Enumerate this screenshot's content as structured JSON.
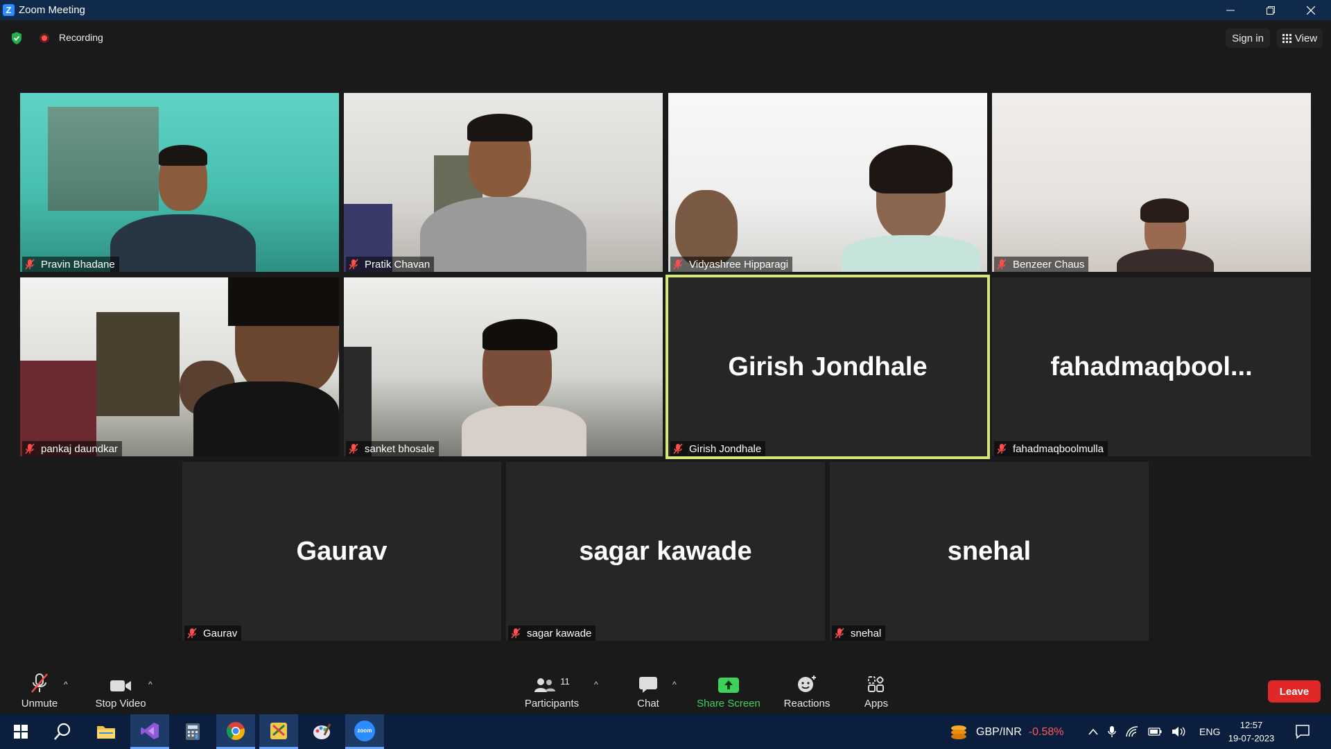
{
  "window": {
    "title": "Zoom Meeting",
    "app_icon_letter": "Z"
  },
  "topbar": {
    "recording_label": "Recording",
    "sign_in_label": "Sign in",
    "view_label": "View"
  },
  "tiles": [
    {
      "name": "Pravin Bhadane",
      "display": "",
      "video": true
    },
    {
      "name": "Pratik Chavan",
      "display": "",
      "video": true
    },
    {
      "name": "Vidyashree Hipparagi",
      "display": "",
      "video": true
    },
    {
      "name": "Benzeer Chaus",
      "display": "",
      "video": true
    },
    {
      "name": "pankaj daundkar",
      "display": "",
      "video": true
    },
    {
      "name": "sanket bhosale",
      "display": "",
      "video": true
    },
    {
      "name": "Girish Jondhale",
      "display": "Girish Jondhale",
      "video": false,
      "active_speaker": true
    },
    {
      "name": "fahadmaqboolmulla",
      "display": "fahadmaqbool...",
      "video": false
    },
    {
      "name": "Gaurav",
      "display": "Gaurav",
      "video": false
    },
    {
      "name": "sagar kawade",
      "display": "sagar kawade",
      "video": false
    },
    {
      "name": "snehal",
      "display": "snehal",
      "video": false
    }
  ],
  "toolbar": {
    "unmute": "Unmute",
    "stop_video": "Stop Video",
    "participants": "Participants",
    "participants_count": "11",
    "chat": "Chat",
    "share_screen": "Share Screen",
    "reactions": "Reactions",
    "apps": "Apps",
    "leave": "Leave"
  },
  "taskbar": {
    "ticker_symbol": "GBP/INR",
    "ticker_change": "-0.58%",
    "language": "ENG",
    "time": "12:57",
    "date": "19-07-2023",
    "zoom_icon_text": "zoom"
  },
  "colors": {
    "active_speaker_border": "#d7e87a",
    "share_green": "#3ed25a",
    "leave_red": "#e02828",
    "ticker_negative": "#ff5a5a"
  }
}
